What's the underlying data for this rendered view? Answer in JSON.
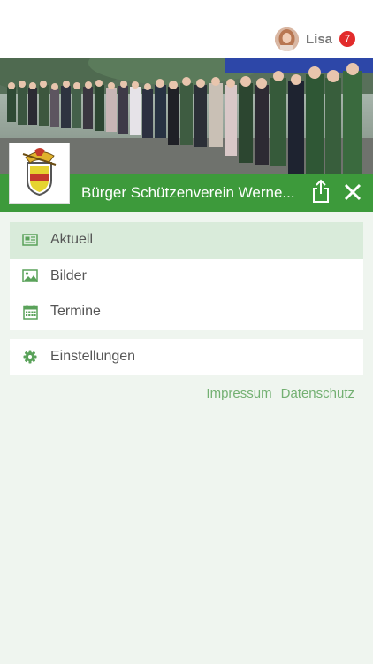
{
  "user": {
    "name": "Lisa",
    "notifications": "7"
  },
  "header": {
    "title": "Bürger Schützenverein Werne..."
  },
  "menu": {
    "items": [
      {
        "label": "Aktuell",
        "icon": "newspaper-icon",
        "active": true
      },
      {
        "label": "Bilder",
        "icon": "image-icon",
        "active": false
      },
      {
        "label": "Termine",
        "icon": "calendar-icon",
        "active": false
      }
    ],
    "settings": {
      "label": "Einstellungen",
      "icon": "gear-icon"
    }
  },
  "footer_links": {
    "impressum": "Impressum",
    "datenschutz": "Datenschutz"
  },
  "colors": {
    "brand_green": "#3d9a3b",
    "active_bg": "#d9ebda",
    "icon_green": "#5aa25a",
    "badge_red": "#e22b2b"
  }
}
